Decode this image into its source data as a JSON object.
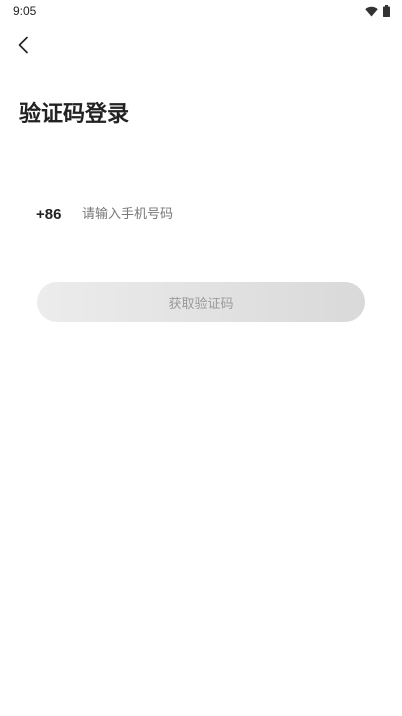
{
  "status_bar": {
    "time": "9:05",
    "wifi_icon": "wifi-icon",
    "battery_icon": "battery-icon"
  },
  "header": {
    "back_icon": "chevron-left-icon",
    "title": "验证码登录"
  },
  "form": {
    "country_code": "+86",
    "phone_value": "",
    "phone_placeholder": "请输入手机号码",
    "submit_label": "获取验证码"
  },
  "colors": {
    "background": "#ffffff",
    "text_primary": "#222222",
    "placeholder": "#777777",
    "button_gradient_start": "#ececec",
    "button_gradient_end": "#d9d9d9",
    "button_text_disabled": "#9a9a9a"
  }
}
